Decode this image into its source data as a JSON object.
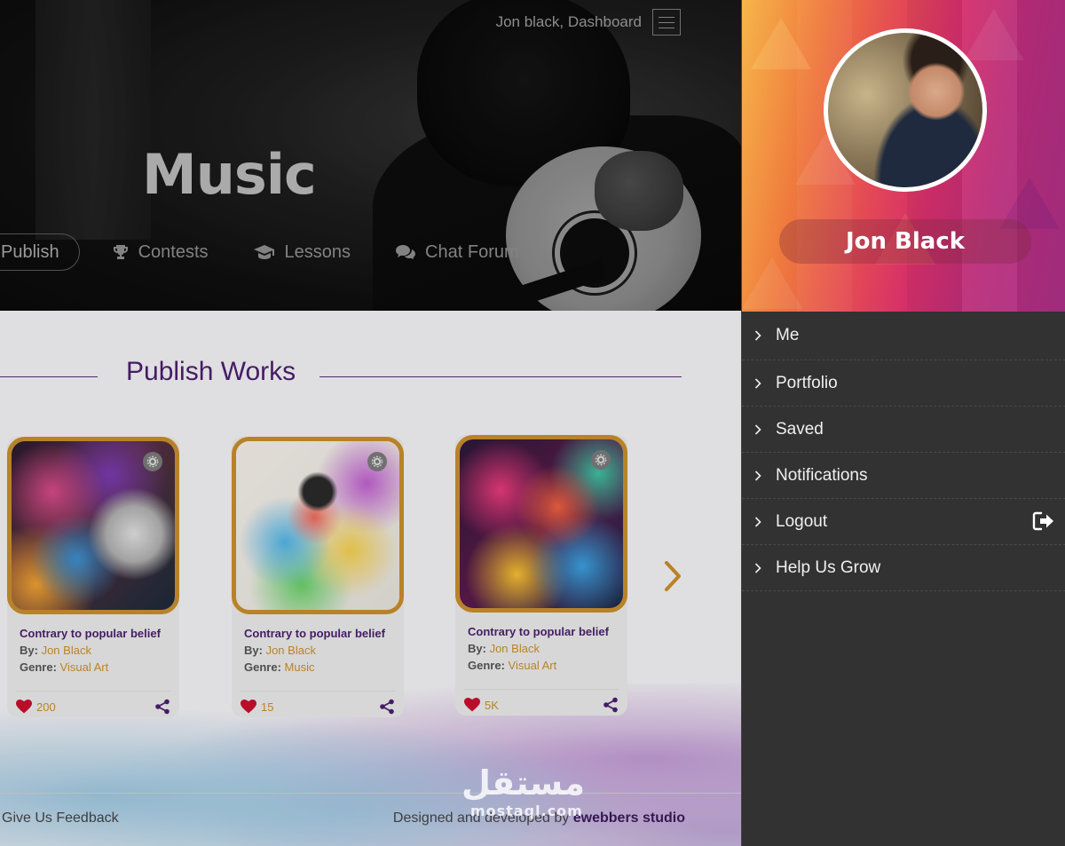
{
  "header": {
    "user_link": "Jon black, Dashboard",
    "title": "Music"
  },
  "nav": {
    "items": [
      {
        "label": "Publish",
        "icon": "trophy-icon"
      },
      {
        "label": "Contests",
        "icon": "trophy-icon"
      },
      {
        "label": "Lessons",
        "icon": "graduation-cap-icon"
      },
      {
        "label": "Chat Forum",
        "icon": "chat-icon"
      }
    ]
  },
  "section": {
    "title": "Publish Works"
  },
  "cards": [
    {
      "title": "Contrary to popular belief",
      "by_label": "By:",
      "author": "Jon Black",
      "genre_label": "Genre:",
      "genre": "Visual Art",
      "likes": "200"
    },
    {
      "title": "Contrary to popular belief",
      "by_label": "By:",
      "author": "Jon Black",
      "genre_label": "Genre:",
      "genre": "Music",
      "likes": "15"
    },
    {
      "title": "Contrary to popular belief",
      "by_label": "By:",
      "author": "Jon Black",
      "genre_label": "Genre:",
      "genre": "Visual Art",
      "likes": "5K"
    }
  ],
  "footer": {
    "feedback": "Give Us Feedback",
    "credit_prefix": "Designed and developed by",
    "credit_brand": "ewebbers studio"
  },
  "drawer": {
    "user_name": "Jon Black",
    "menu": [
      {
        "label": "Me"
      },
      {
        "label": "Portfolio"
      },
      {
        "label": "Saved"
      },
      {
        "label": "Notifications"
      },
      {
        "label": "Logout"
      },
      {
        "label": "Help Us Grow"
      }
    ]
  },
  "watermark": {
    "arabic": "مستقل",
    "latin": "mostaql.com"
  },
  "colors": {
    "accent": "#c98e2b",
    "brand_purple": "#4a1f6e",
    "drawer_bg": "#323232",
    "like_red": "#c8102e"
  }
}
